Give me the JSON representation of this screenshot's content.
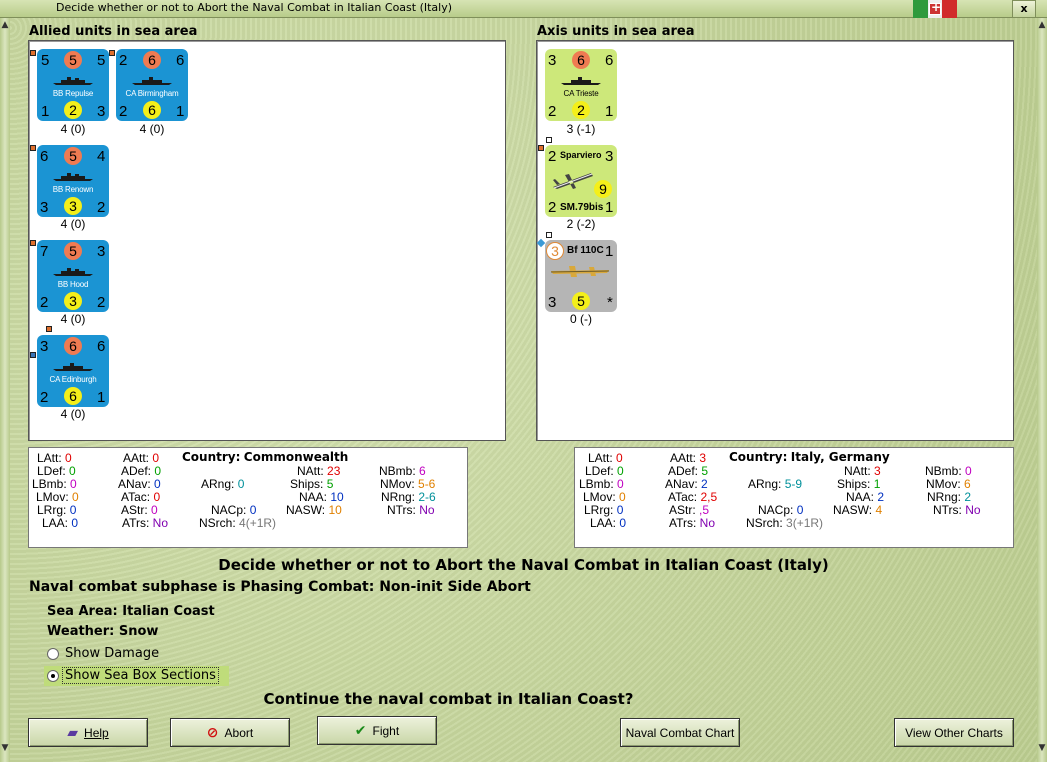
{
  "window": {
    "title": "Decide whether or not to Abort the Naval Combat in Italian Coast (Italy)",
    "close": "x"
  },
  "allied": {
    "label": "Allied units in sea area",
    "units": [
      {
        "name": "BB Repulse",
        "tl": "5",
        "tc": "5",
        "tr": "5",
        "bl": "1",
        "bc": "2",
        "br": "3",
        "caption": "4 (0)"
      },
      {
        "name": "CA Birmingham",
        "tl": "2",
        "tc": "6",
        "tr": "6",
        "bl": "2",
        "bc": "6",
        "br": "1",
        "caption": "4 (0)"
      },
      {
        "name": "BB Renown",
        "tl": "6",
        "tc": "5",
        "tr": "4",
        "bl": "3",
        "bc": "3",
        "br": "2",
        "caption": "4 (0)"
      },
      {
        "name": "BB Hood",
        "tl": "7",
        "tc": "5",
        "tr": "3",
        "bl": "2",
        "bc": "3",
        "br": "2",
        "caption": "4 (0)"
      },
      {
        "name": "CA Edinburgh",
        "tl": "3",
        "tc": "6",
        "tr": "6",
        "bl": "2",
        "bc": "6",
        "br": "1",
        "caption": "4 (0)"
      }
    ]
  },
  "axis": {
    "label": "Axis units in sea area",
    "units": [
      {
        "name": "CA Trieste",
        "tl": "3",
        "tc": "6",
        "tr": "6",
        "bl": "2",
        "bc": "2",
        "br": "1",
        "caption": "3 (-1)"
      },
      {
        "name": "Sparviero",
        "name2": "SM.79bis",
        "tl": "2",
        "tr": "3",
        "mid": "9",
        "bl": "2",
        "br": "1",
        "caption": "2 (-2)"
      },
      {
        "name": "Bf 110C",
        "tl": "3",
        "tr": "1",
        "bl": "3",
        "bc": "5",
        "br": "*",
        "caption": "0 (-)"
      }
    ]
  },
  "allied_stats": {
    "country_label": "Country:",
    "country": "Commonwealth",
    "LAtt": "0",
    "LDef": "0",
    "LBmb": "0",
    "LMov": "0",
    "LRrg": "0",
    "LAA": "0",
    "AAtt": "0",
    "ADef": "0",
    "ANav": "0",
    "ATac": "0",
    "AStr": "0",
    "ATrs": "No",
    "ARng": "0",
    "NAtt": "23",
    "Ships": "5",
    "NAA": "10",
    "NASW": "10",
    "NACp": "0",
    "NSrch": "4(+1R)",
    "NBmb": "6",
    "NMov": "5-6",
    "NRng": "2-6",
    "NTrs": "No"
  },
  "axis_stats": {
    "country_label": "Country:",
    "country": "Italy, Germany",
    "LAtt": "0",
    "LDef": "0",
    "LBmb": "0",
    "LMov": "0",
    "LRrg": "0",
    "LAA": "0",
    "AAtt": "3",
    "ADef": "5",
    "ANav": "2",
    "ATac": "2,5",
    "AStr": ",5",
    "ATrs": "No",
    "ARng": "5-9",
    "NAtt": "3",
    "Ships": "1",
    "NAA": "2",
    "NASW": "4",
    "NACp": "0",
    "NSrch": "3(+1R)",
    "NBmb": "0",
    "NMov": "6",
    "NRng": "2",
    "NTrs": "No"
  },
  "stat_labels": {
    "LAtt": "LAtt:",
    "LDef": "LDef:",
    "LBmb": "LBmb:",
    "LMov": "LMov:",
    "LRrg": "LRrg:",
    "LAA": "LAA:",
    "AAtt": "AAtt:",
    "ADef": "ADef:",
    "ANav": "ANav:",
    "ATac": "ATac:",
    "AStr": "AStr:",
    "ATrs": "ATrs:",
    "ARng": "ARng:",
    "NAtt": "NAtt:",
    "Ships": "Ships:",
    "NAA": "NAA:",
    "NASW": "NASW:",
    "NACp": "NACp:",
    "NSrch": "NSrch:",
    "NBmb": "NBmb:",
    "NMov": "NMov:",
    "NRng": "NRng:",
    "NTrs": "NTrs:"
  },
  "main": {
    "heading": "Decide whether or not to Abort the Naval Combat in Italian Coast (Italy)",
    "subphase": "Naval combat subphase is Phasing Combat: Non-init Side Abort",
    "sea_area": "Sea Area:  Italian Coast",
    "weather": "Weather:  Snow",
    "show_damage": "Show Damage",
    "show_sea_box": "Show Sea Box Sections",
    "question": "Continue the naval combat in Italian Coast?"
  },
  "buttons": {
    "help": "Help",
    "abort": "Abort",
    "fight": "Fight",
    "naval_chart": "Naval Combat Chart",
    "other_charts": "View Other Charts"
  },
  "colors": {
    "allied_counter": "#1b94d3",
    "axis_naval_counter": "#cde87a",
    "german_counter": "#b5b5b5",
    "background": "#c9d8a3"
  }
}
